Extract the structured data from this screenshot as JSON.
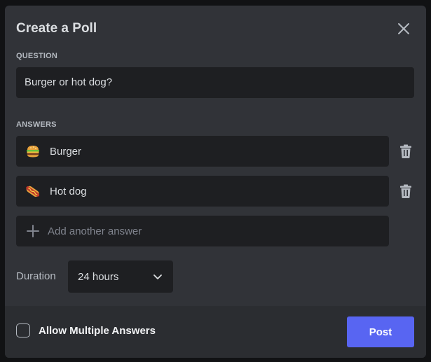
{
  "modal": {
    "title": "Create a Poll"
  },
  "question": {
    "label": "QUESTION",
    "value": "Burger or hot dog?"
  },
  "answers": {
    "label": "ANSWERS",
    "items": [
      {
        "emoji": "burger-icon",
        "text": "Burger"
      },
      {
        "emoji": "hot-dog-icon",
        "text": "Hot dog"
      }
    ],
    "add_placeholder": "Add another answer"
  },
  "duration": {
    "label": "Duration",
    "value": "24 hours"
  },
  "footer": {
    "multiple_answers_label": "Allow Multiple Answers",
    "post_label": "Post"
  },
  "colors": {
    "accent": "#5865f2",
    "modal_bg": "#313338",
    "input_bg": "#1e1f22",
    "footer_bg": "#2b2d31"
  }
}
